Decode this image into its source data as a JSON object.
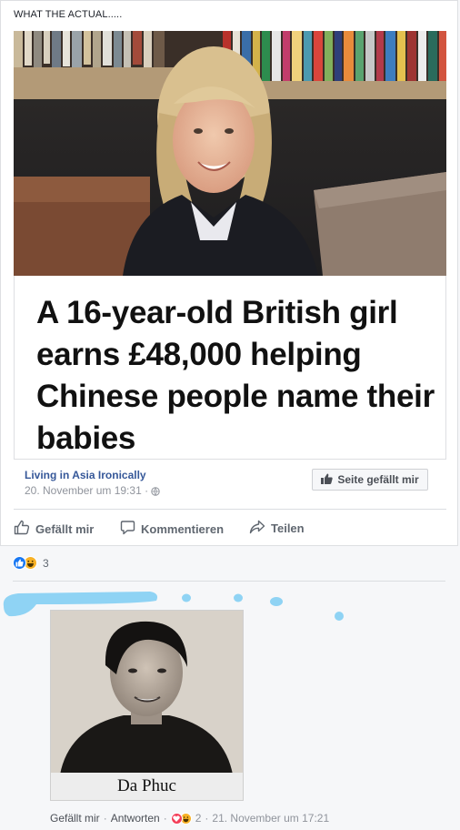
{
  "post": {
    "caption": "WHAT THE ACTUAL.....",
    "headline": "A 16-year-old British girl earns £48,000 helping Chinese people name their babies",
    "page_name": "Living in Asia Ironically",
    "timestamp": "20. November um 19:31",
    "meta_separator": "·",
    "like_page_label": "Seite gefällt mir"
  },
  "actions": {
    "like": "Gefällt mir",
    "comment": "Kommentieren",
    "share": "Teilen"
  },
  "reactions": {
    "count": "3",
    "types": [
      "like-icon",
      "haha-icon"
    ]
  },
  "comment": {
    "photo_label": "Da Phuc",
    "like_label": "Gefällt mir",
    "reply_label": "Antworten",
    "separator": "·",
    "reaction_count": "2",
    "reaction_types": [
      "love-icon",
      "haha-icon"
    ],
    "timestamp": "21. November um 17:21"
  },
  "colors": {
    "link": "#365899",
    "like_blue": "#1877f2",
    "love_red": "#f33e58",
    "haha_yellow": "#f7b125",
    "redaction": "#8fd3f4"
  }
}
